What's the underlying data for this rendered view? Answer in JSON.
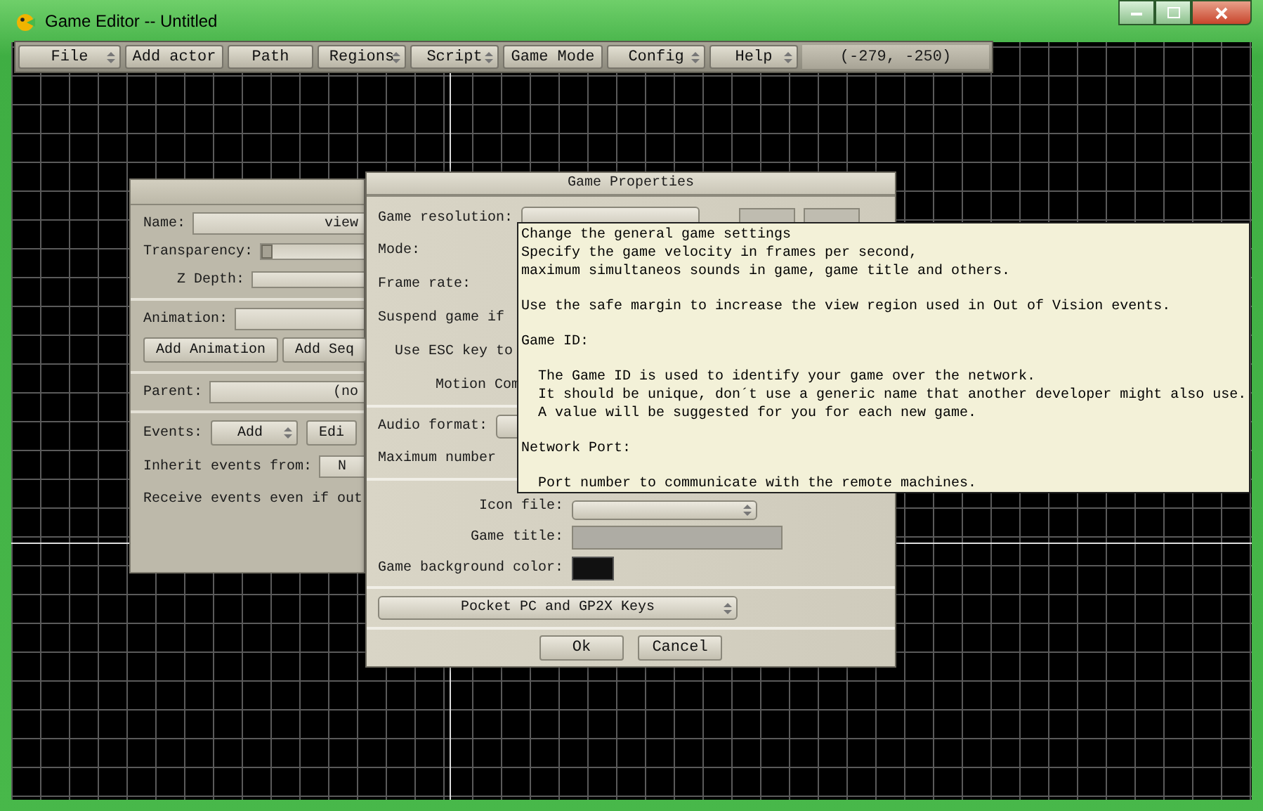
{
  "window": {
    "title": "Game Editor -- Untitled"
  },
  "menu": [
    {
      "label": "File",
      "dropdown": true
    },
    {
      "label": "Add actor",
      "dropdown": false
    },
    {
      "label": "Path",
      "dropdown": false
    },
    {
      "label": "Regions",
      "dropdown": true
    },
    {
      "label": "Script",
      "dropdown": true
    },
    {
      "label": "Game Mode",
      "dropdown": false
    },
    {
      "label": "Config",
      "dropdown": true
    },
    {
      "label": "Help",
      "dropdown": true
    }
  ],
  "coordinates": "(-279, -250)",
  "actor_control": {
    "name_label": "Name:",
    "name_value": "view",
    "transparency_label": "Transparency:",
    "transparency": {
      "level": 0
    },
    "z_depth_label": "Z Depth:",
    "animation_label": "Animation:",
    "buttons": [
      "Add Animation",
      "Add Seq"
    ],
    "parent_label": "Parent:",
    "parent_value": "(no",
    "events_label": "Events:",
    "events_buttons": [
      {
        "label": "Add",
        "dropdown": true
      },
      {
        "label": "Edi",
        "dropdown": false
      }
    ],
    "inherit_label": "Inherit events from:",
    "inherit_value": "N",
    "receive_label": "Receive events even if out"
  },
  "game_properties": {
    "title": "Game Properties",
    "rows": [
      {
        "label": "Game resolution:",
        "kind": "resolution"
      },
      {
        "label": "Mode:",
        "kind": "plain"
      },
      {
        "label": "Frame rate:",
        "kind": "plain"
      },
      {
        "label": "Suspend game if",
        "kind": "plain"
      },
      {
        "label": "Use ESC key to",
        "kind": "indent1"
      },
      {
        "label": "Motion Com",
        "kind": "indent2"
      }
    ],
    "audio_rows": [
      {
        "label": "Audio format:",
        "kind": "dropdown"
      },
      {
        "label": "Maximum number",
        "kind": "plain"
      }
    ],
    "icon_label": "Icon file:",
    "title_label": "Game title:",
    "color_label": "Game background color:",
    "keys_button": "Pocket PC and GP2X Keys",
    "ok": "Ok",
    "cancel": "Cancel"
  },
  "tooltip": {
    "paragraphs": [
      {
        "indented": false,
        "lines": [
          "Change the general game settings",
          "Specify the game velocity in frames per second,",
          "maximum simultaneos sounds in game, game title and others."
        ]
      },
      {
        "indented": false,
        "lines": [
          "Use the safe margin to increase the view region used in Out of Vision events."
        ]
      },
      {
        "indented": false,
        "lines": [
          "Game ID:"
        ]
      },
      {
        "indented": true,
        "lines": [
          "The Game ID is used to identify your game over the network.",
          "It should be unique, don´t use a generic name that another developer might also use.",
          "A value will be suggested for you for each new game."
        ]
      },
      {
        "indented": false,
        "lines": [
          "Network Port:"
        ]
      },
      {
        "indented": true,
        "lines": [
          "Port number to communicate with the remote machines."
        ]
      }
    ]
  }
}
